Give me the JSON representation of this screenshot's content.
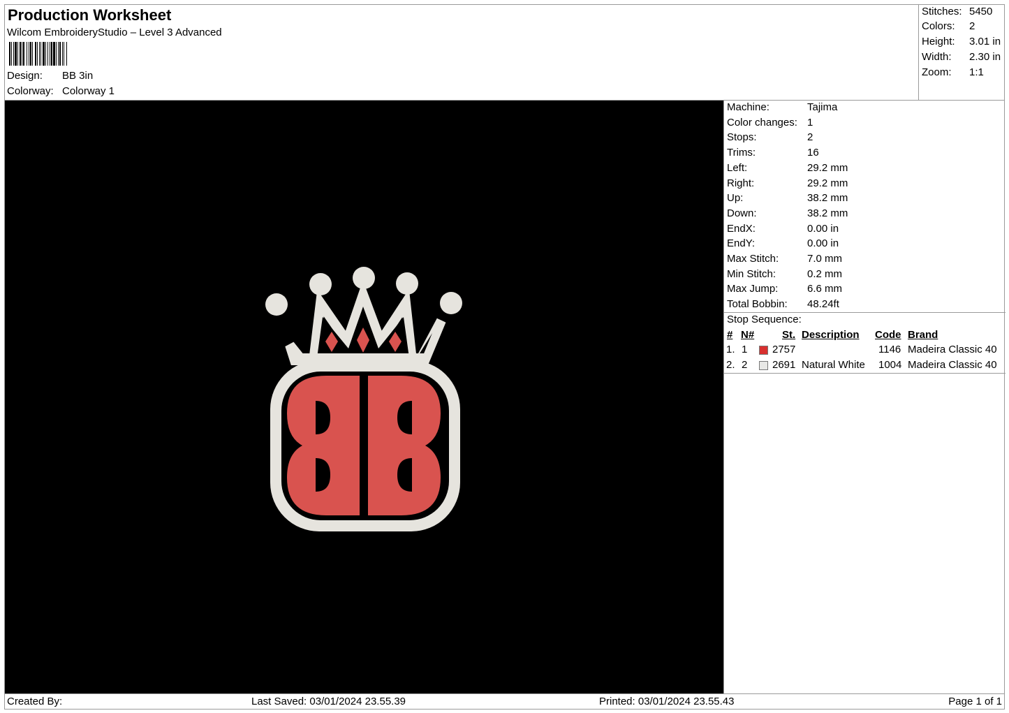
{
  "header": {
    "title": "Production Worksheet",
    "software": "Wilcom EmbroideryStudio – Level 3 Advanced",
    "design_label": "Design:",
    "design_value": "BB 3in",
    "colorway_label": "Colorway:",
    "colorway_value": "Colorway 1"
  },
  "stats": {
    "stitches_label": "Stitches:",
    "stitches_value": "5450",
    "colors_label": "Colors:",
    "colors_value": "2",
    "height_label": "Height:",
    "height_value": "3.01 in",
    "width_label": "Width:",
    "width_value": "2.30 in",
    "zoom_label": "Zoom:",
    "zoom_value": "1:1"
  },
  "machine_info": [
    {
      "label": "Machine:",
      "value": "Tajima"
    },
    {
      "label": "Color changes:",
      "value": "1"
    },
    {
      "label": "Stops:",
      "value": "2"
    },
    {
      "label": "Trims:",
      "value": "16"
    },
    {
      "label": "Left:",
      "value": "29.2 mm"
    },
    {
      "label": "Right:",
      "value": "29.2 mm"
    },
    {
      "label": "Up:",
      "value": "38.2 mm"
    },
    {
      "label": "Down:",
      "value": "38.2 mm"
    },
    {
      "label": "EndX:",
      "value": "0.00 in"
    },
    {
      "label": "EndY:",
      "value": "0.00 in"
    },
    {
      "label": "Max Stitch:",
      "value": "7.0 mm"
    },
    {
      "label": "Min Stitch:",
      "value": "0.2 mm"
    },
    {
      "label": "Max Jump:",
      "value": "6.6 mm"
    },
    {
      "label": "Total Bobbin:",
      "value": "48.24ft"
    }
  ],
  "stop_sequence": {
    "title": "Stop Sequence:",
    "columns": [
      "#",
      "N#",
      "St.",
      "Description",
      "Code",
      "Brand"
    ],
    "rows": [
      {
        "num": "1.",
        "n": "1",
        "color": "#d8302f",
        "st": "2757",
        "description": "",
        "code": "1146",
        "brand": "Madeira Classic 40"
      },
      {
        "num": "2.",
        "n": "2",
        "color": "#e8e8e6",
        "st": "2691",
        "description": "Natural White",
        "code": "1004",
        "brand": "Madeira Classic 40"
      }
    ]
  },
  "design_colors": {
    "red": "#d9534f",
    "red_dark": "#b83a37",
    "white": "#e6e4de",
    "white_shade": "#cfccc4",
    "background": "#000000"
  },
  "footer": {
    "created_by": "Created By:",
    "last_saved": "Last Saved: 03/01/2024 23.55.39",
    "printed": "Printed: 03/01/2024 23.55.43",
    "page": "Page 1 of 1"
  }
}
